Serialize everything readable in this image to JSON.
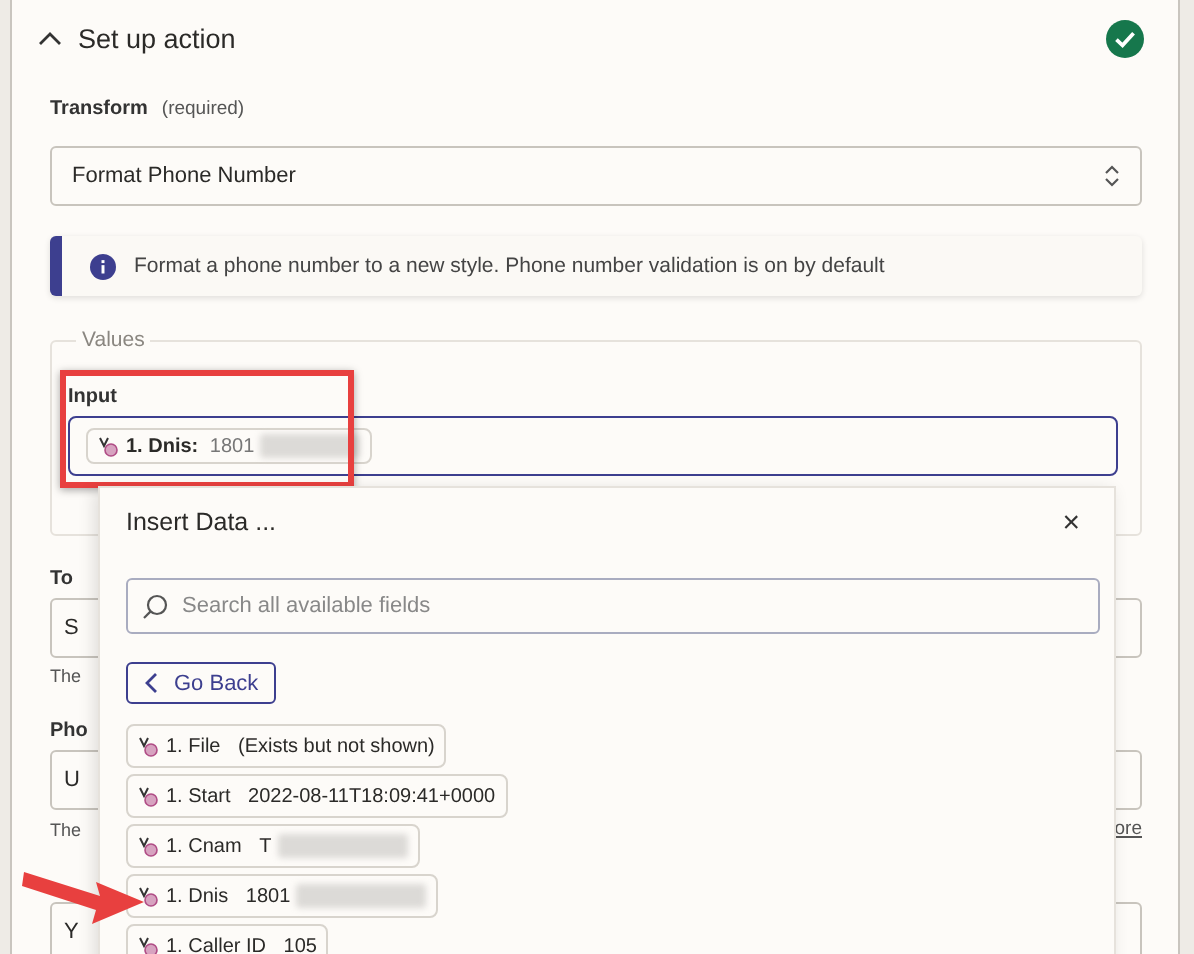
{
  "section": {
    "title": "Set up action",
    "expanded": true,
    "complete": true
  },
  "transform": {
    "label": "Transform",
    "note": "(required)",
    "value": "Format Phone Number"
  },
  "info": "Format a phone number to a new style. Phone number validation is on by default",
  "values": {
    "legend": "Values",
    "input_label": "Input",
    "pill": {
      "label": "1. Dnis:",
      "value": "1801",
      "redacted": true
    }
  },
  "behind": {
    "to_label": "To",
    "to_value": "S",
    "to_help": "The",
    "phone_label": "Pho",
    "phone_value": "U",
    "phone_help": "The",
    "more_link": "ore",
    "last_value": "Y"
  },
  "popover": {
    "title": "Insert Data ...",
    "close": "×",
    "search": {
      "placeholder": "Search all available fields"
    },
    "back": "Go Back",
    "items": [
      {
        "label": "1. File",
        "value": "(Exists but not shown)",
        "redacted": false
      },
      {
        "label": "1. Start",
        "value": "2022-08-11T18:09:41+0000",
        "redacted": false
      },
      {
        "label": "1. Cnam",
        "value": "T",
        "redacted": true
      },
      {
        "label": "1. Dnis",
        "value": "1801",
        "redacted": true
      },
      {
        "label": "1. Caller ID",
        "value": "105",
        "redacted": false
      }
    ]
  }
}
